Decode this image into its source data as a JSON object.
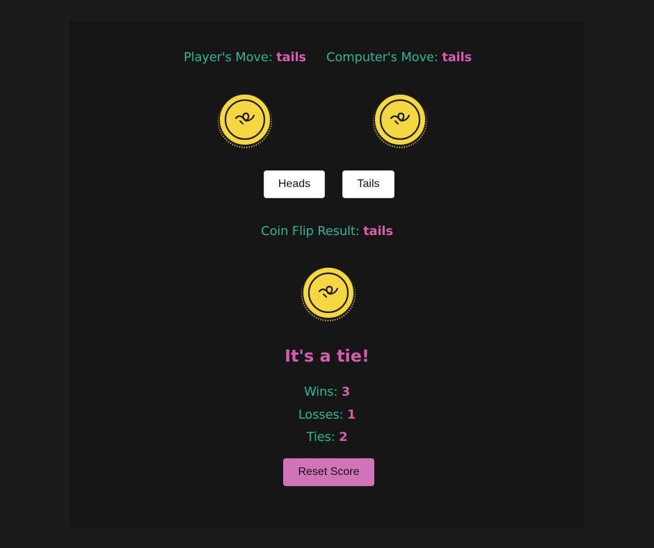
{
  "moves": {
    "player_label": "Player's Move:",
    "player_value": "tails",
    "computer_label": "Computer's Move:",
    "computer_value": "tails"
  },
  "icons": {
    "player_coin": "coin-tails-icon",
    "computer_coin": "coin-tails-icon",
    "result_coin": "coin-tails-icon"
  },
  "buttons": {
    "heads_label": "Heads",
    "tails_label": "Tails",
    "reset_label": "Reset Score"
  },
  "result": {
    "label": "Coin Flip Result:",
    "value": "tails",
    "outcome": "It's a tie!"
  },
  "score": {
    "wins_label": "Wins:",
    "wins": "3",
    "losses_label": "Losses:",
    "losses": "1",
    "ties_label": "Ties:",
    "ties": "2"
  },
  "colors": {
    "background": "#1b1b1b",
    "panel": "#161616",
    "label_teal": "#2fb59a",
    "accent_pink": "#d85cb0",
    "coin_gold": "#f5d742",
    "reset_button": "#d073b8"
  }
}
